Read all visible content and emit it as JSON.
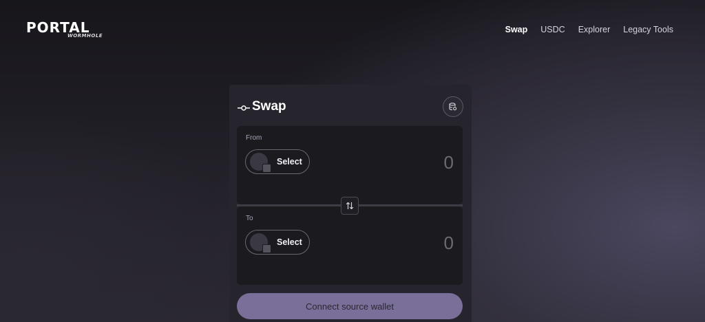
{
  "brand": {
    "name": "PORTAL",
    "subtitle": "WORMHOLE"
  },
  "nav": {
    "items": [
      {
        "label": "Swap",
        "active": true
      },
      {
        "label": "USDC",
        "active": false
      },
      {
        "label": "Explorer",
        "active": false
      },
      {
        "label": "Legacy Tools",
        "active": false
      }
    ]
  },
  "card": {
    "title": "Swap",
    "title_icon": "swap-route-icon",
    "settings_icon": "database-settings-icon",
    "from": {
      "label": "From",
      "token_select_label": "Select",
      "amount": "0"
    },
    "flip_icon": "swap-arrows-icon",
    "to": {
      "label": "To",
      "token_select_label": "Select",
      "amount": "0"
    },
    "connect_button_label": "Connect source wallet"
  },
  "colors": {
    "accent_button": "#7a6f98",
    "card_bg": "#26242c",
    "panel_bg": "#1b1a1f"
  }
}
